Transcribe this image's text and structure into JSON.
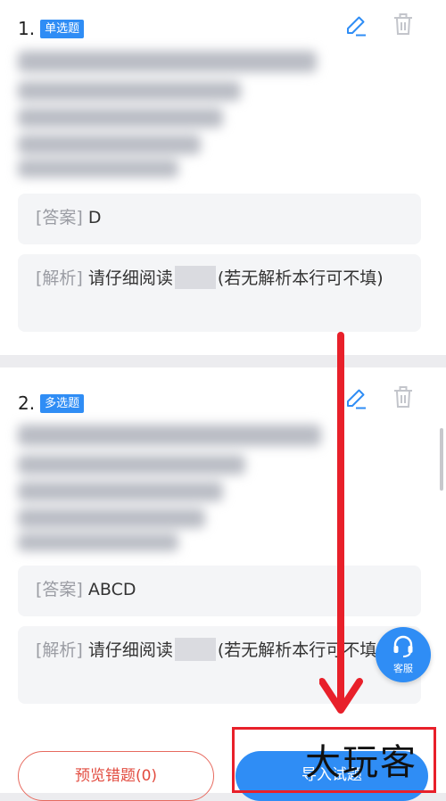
{
  "questions": [
    {
      "number": "1.",
      "type_badge": "单选题",
      "answer_bracket": "[答案]",
      "answer_value": "D",
      "analysis_bracket": "[解析]",
      "analysis_before": "请仔细阅读",
      "analysis_after": "(若无解析本行可不填)"
    },
    {
      "number": "2.",
      "type_badge": "多选题",
      "answer_bracket": "[答案]",
      "answer_value": "ABCD",
      "analysis_bracket": "[解析]",
      "analysis_before": "请仔细阅读",
      "analysis_after": "(若无解析本行可不填)"
    }
  ],
  "bottom_bar": {
    "preview_label": "预览错题(0)",
    "import_label": "导入试题"
  },
  "floating": {
    "service_label": "客服",
    "service_icon": "headset-icon"
  },
  "watermark": "大玩客",
  "colors": {
    "accent": "#2f8df5",
    "danger": "#e24b3f",
    "annotation": "#e8202a"
  }
}
